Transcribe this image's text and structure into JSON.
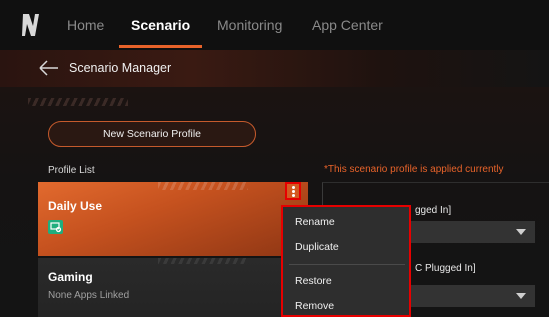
{
  "nav": {
    "tabs": [
      {
        "label": "Home"
      },
      {
        "label": "Scenario"
      },
      {
        "label": "Monitoring"
      },
      {
        "label": "App Center"
      }
    ],
    "active_tab": "Scenario"
  },
  "breadcrumb": {
    "title": "Scenario Manager"
  },
  "sidebar": {
    "new_profile_label": "New Scenario Profile",
    "profile_list_label": "Profile List",
    "profiles": [
      {
        "name": "Daily Use",
        "subtitle": "",
        "selected": true
      },
      {
        "name": "Gaming",
        "subtitle": "None Apps Linked",
        "selected": false
      }
    ]
  },
  "main": {
    "applied_note": "*This scenario profile is applied currently",
    "setting_1_label_partial": "gged In]",
    "setting_2_label_partial": "C Plugged In]"
  },
  "context_menu": {
    "items": [
      {
        "label": "Rename"
      },
      {
        "label": "Duplicate"
      },
      {
        "label": "Restore"
      },
      {
        "label": "Remove"
      }
    ]
  },
  "colors": {
    "accent": "#e8632a",
    "highlight_border": "#e60000",
    "applied_note": "#e8632a"
  }
}
